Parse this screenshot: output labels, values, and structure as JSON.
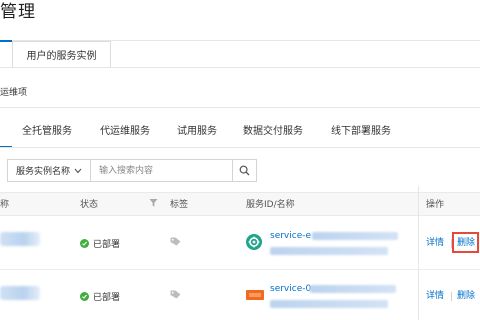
{
  "header": {
    "title": "管理"
  },
  "top_tabs": [
    {
      "label": "用户的服务实例"
    }
  ],
  "section": {
    "label": "运维项"
  },
  "service_tabs": [
    {
      "label": "全托管服务"
    },
    {
      "label": "代运维服务"
    },
    {
      "label": "试用服务"
    },
    {
      "label": "数据交付服务"
    },
    {
      "label": "线下部署服务"
    }
  ],
  "search": {
    "field_label": "服务实例名称",
    "placeholder": "输入搜索内容",
    "icon": "search-icon"
  },
  "table": {
    "columns": [
      "称",
      "状态",
      "标签",
      "服务ID/名称",
      "操作"
    ],
    "rows": [
      {
        "status": "已部署",
        "service_id": "service-e",
        "actions": [
          "详情",
          "删除"
        ]
      },
      {
        "status": "已部署",
        "service_id": "service-0",
        "actions": [
          "详情",
          "删除"
        ]
      }
    ]
  },
  "colors": {
    "accent": "#0070cc",
    "success": "#3fae3f",
    "highlight": "#e8483a"
  }
}
